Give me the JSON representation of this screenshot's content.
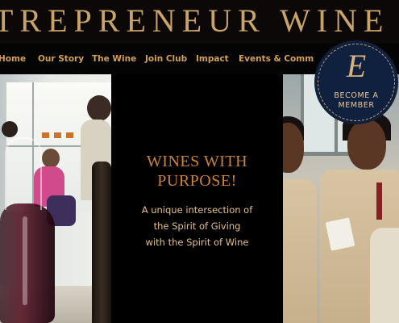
{
  "header": {
    "title": "TREPRENEUR WINE"
  },
  "nav": {
    "items": [
      {
        "label": "Home"
      },
      {
        "label": "Our Story"
      },
      {
        "label": "The Wine"
      },
      {
        "label": "Join Club"
      },
      {
        "label": "Impact"
      },
      {
        "label": "Events & Comm"
      }
    ]
  },
  "hero": {
    "headline_line1": "WINES WITH",
    "headline_line2": "PURPOSE!",
    "subtitle_line1": "A unique intersection of",
    "subtitle_line2": "the Spirit of Giving",
    "subtitle_line3": "with the Spirit of Wine"
  },
  "badge": {
    "monogram": "E",
    "label_line1": "BECOME A",
    "label_line2": "MEMBER"
  },
  "colors": {
    "accent": "#c9a46a",
    "nav_text": "#d2a055",
    "headline": "#c9823a",
    "badge_bg": "#10203f"
  }
}
